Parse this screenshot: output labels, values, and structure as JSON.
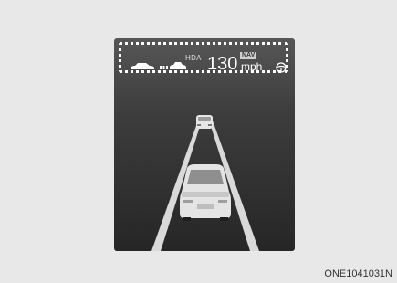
{
  "hud": {
    "hda_label": "HDA",
    "set_speed": "130",
    "speed_unit": "mph",
    "nav_badge": "NAV"
  },
  "icons": [
    "car-icon",
    "distance-bars-icon",
    "car-icon",
    "steering-wheel-icon"
  ],
  "figure_code": "ONE1041031N"
}
